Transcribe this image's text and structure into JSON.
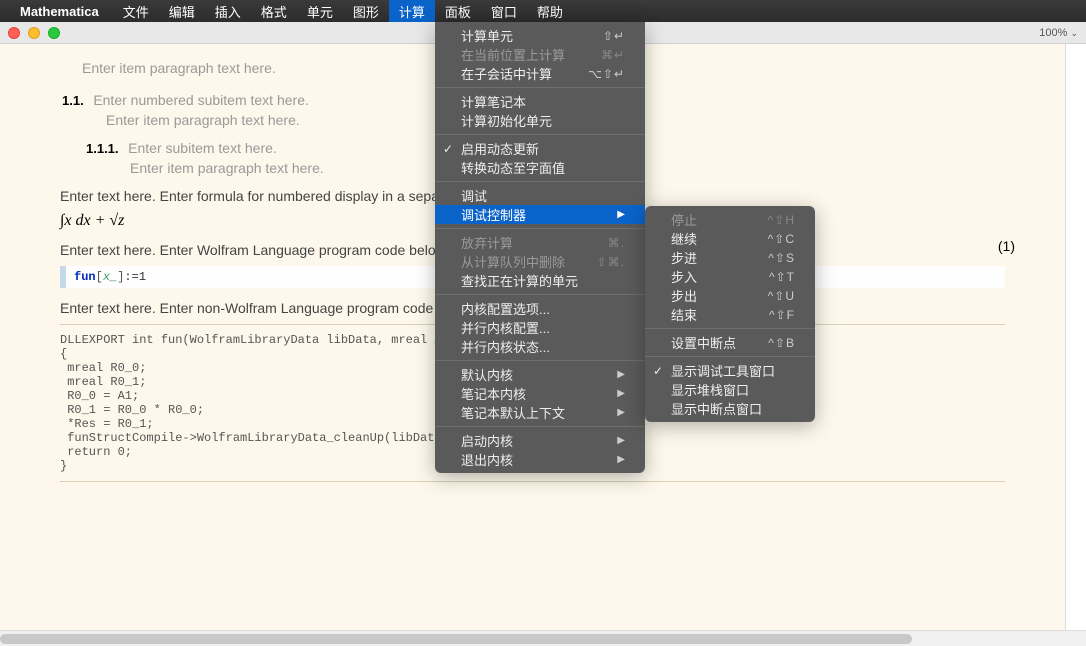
{
  "menubar": {
    "app": "Mathematica",
    "items": [
      "文件",
      "编辑",
      "插入",
      "格式",
      "单元",
      "图形",
      "计算",
      "面板",
      "窗口",
      "帮助"
    ],
    "active_index": 6
  },
  "window": {
    "zoom": "100%"
  },
  "doc": {
    "enter_item_para": "Enter item paragraph text here.",
    "sub_num": "1.1.",
    "sub_text": "Enter numbered subitem text here.",
    "sub_para": "Enter item paragraph text here.",
    "subsub_num": "1.1.1.",
    "subsub_text": "Enter subitem text here.",
    "subsub_para": "Enter item paragraph text here.",
    "formula_intro": "Enter text here. Enter formula for numbered display in a sepa",
    "formula": "∫x dx + √z",
    "formula_num": "(1)",
    "code_intro": "Enter text here. Enter Wolfram Language program code belo",
    "code_wl_fun": "fun",
    "code_wl_x": "x_",
    "code_wl_rest": ":=1",
    "noncode_intro": "Enter text here. Enter non-Wolfram Language program code",
    "code_c": "DLLEXPORT int fun(WolframLibraryData libData, mreal A\n{\n mreal R0_0;\n mreal R0_1;\n R0_0 = A1;\n R0_1 = R0_0 * R0_0;\n *Res = R0_1;\n funStructCompile->WolframLibraryData_cleanUp(libData, 1);\n return 0;\n}"
  },
  "menu_main": [
    {
      "label": "计算单元",
      "shortcut": "⇧↵",
      "type": "item"
    },
    {
      "label": "在当前位置上计算",
      "shortcut": "⌘↵",
      "type": "disabled"
    },
    {
      "label": "在子会话中计算",
      "shortcut": "⌥⇧↵",
      "type": "item"
    },
    {
      "type": "sep"
    },
    {
      "label": "计算笔记本",
      "type": "item"
    },
    {
      "label": "计算初始化单元",
      "type": "item"
    },
    {
      "type": "sep"
    },
    {
      "label": "启用动态更新",
      "type": "item",
      "checked": true
    },
    {
      "label": "转换动态至字面值",
      "type": "item"
    },
    {
      "type": "sep"
    },
    {
      "label": "调试",
      "type": "item"
    },
    {
      "label": "调试控制器",
      "type": "highlight",
      "arrow": true
    },
    {
      "type": "sep"
    },
    {
      "label": "放弃计算",
      "shortcut": "⌘.",
      "type": "disabled"
    },
    {
      "label": "从计算队列中删除",
      "shortcut": "⇧⌘.",
      "type": "disabled"
    },
    {
      "label": "查找正在计算的单元",
      "type": "item"
    },
    {
      "type": "sep"
    },
    {
      "label": "内核配置选项...",
      "type": "item"
    },
    {
      "label": "并行内核配置...",
      "type": "item"
    },
    {
      "label": "并行内核状态...",
      "type": "item"
    },
    {
      "type": "sep"
    },
    {
      "label": "默认内核",
      "type": "item",
      "arrow": true
    },
    {
      "label": "笔记本内核",
      "type": "item",
      "arrow": true
    },
    {
      "label": "笔记本默认上下文",
      "type": "item",
      "arrow": true
    },
    {
      "type": "sep"
    },
    {
      "label": "启动内核",
      "type": "item",
      "arrow": true
    },
    {
      "label": "退出内核",
      "type": "item",
      "arrow": true
    }
  ],
  "menu_sub": [
    {
      "label": "停止",
      "shortcut": "^⇧H",
      "type": "disabled"
    },
    {
      "label": "继续",
      "shortcut": "^⇧C",
      "type": "item"
    },
    {
      "label": "步进",
      "shortcut": "^⇧S",
      "type": "item"
    },
    {
      "label": "步入",
      "shortcut": "^⇧T",
      "type": "item"
    },
    {
      "label": "步出",
      "shortcut": "^⇧U",
      "type": "item"
    },
    {
      "label": "结束",
      "shortcut": "^⇧F",
      "type": "item"
    },
    {
      "type": "sep"
    },
    {
      "label": "设置中断点",
      "shortcut": "^⇧B",
      "type": "item"
    },
    {
      "type": "sep"
    },
    {
      "label": "显示调试工具窗口",
      "type": "item",
      "checked": true
    },
    {
      "label": "显示堆栈窗口",
      "type": "item"
    },
    {
      "label": "显示中断点窗口",
      "type": "item"
    }
  ]
}
